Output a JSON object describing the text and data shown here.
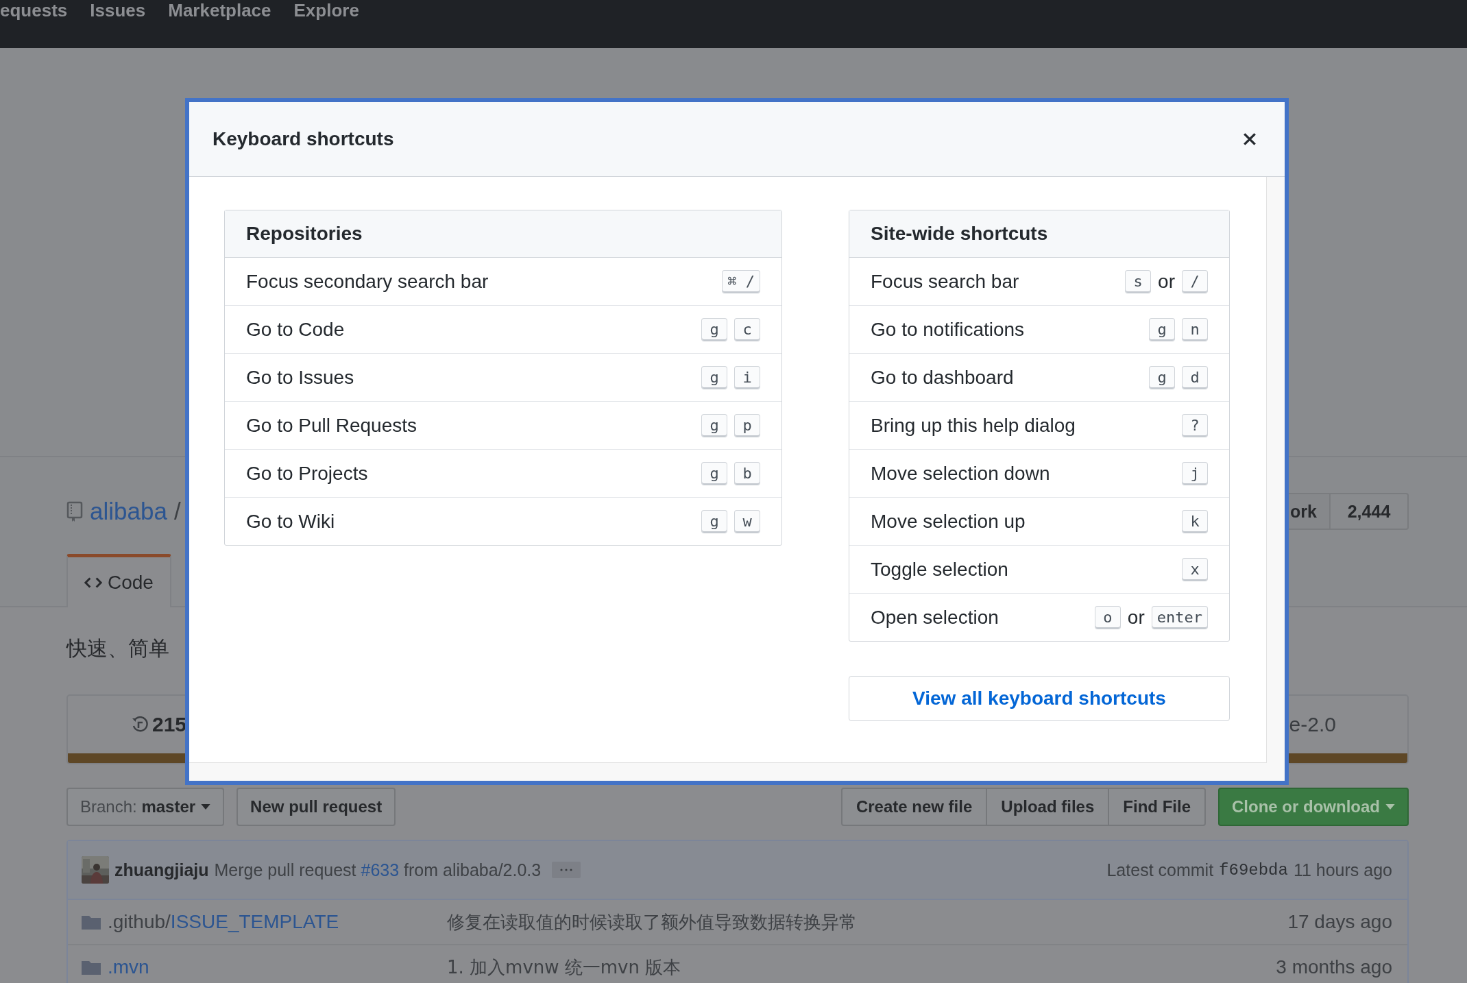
{
  "top_nav": [
    "equests",
    "Issues",
    "Marketplace",
    "Explore"
  ],
  "repo": {
    "owner": "alibaba",
    "separator": "/",
    "fork_label": "ork",
    "fork_count": "2,444"
  },
  "tabs": [
    {
      "label": "Code",
      "selected": true
    }
  ],
  "description": "快速、简单",
  "stats": {
    "commits": "215",
    "license": "e-2.0"
  },
  "branch": {
    "label": "Branch:",
    "value": "master"
  },
  "new_pull_request": "New pull request",
  "file_actions": [
    "Create new file",
    "Upload files",
    "Find File"
  ],
  "clone_button": "Clone or download",
  "commit": {
    "author": "zhuangjiaju",
    "message_before": "Merge pull request",
    "pr": "#633",
    "message_after": "from alibaba/2.0.3",
    "latest_label": "Latest commit",
    "sha": "f69ebda",
    "time": "11 hours ago"
  },
  "files": [
    {
      "path": ".github/",
      "name": "ISSUE_TEMPLATE",
      "message": "修复在读取值的时候读取了额外值导致数据转换异常",
      "age": "17 days ago"
    },
    {
      "name": ".mvn",
      "message": "1. 加入mvnw 统一mvn 版本",
      "age": "3 months ago"
    }
  ],
  "dialog": {
    "title": "Keyboard shortcuts",
    "sections": [
      {
        "title": "Repositories",
        "shortcuts": [
          {
            "label": "Focus secondary search bar",
            "keys": [
              {
                "kind": "key",
                "text": "⌘ /"
              }
            ]
          },
          {
            "label": "Go to Code",
            "keys": [
              {
                "kind": "key",
                "text": "g"
              },
              {
                "kind": "key",
                "text": "c"
              }
            ]
          },
          {
            "label": "Go to Issues",
            "keys": [
              {
                "kind": "key",
                "text": "g"
              },
              {
                "kind": "key",
                "text": "i"
              }
            ]
          },
          {
            "label": "Go to Pull Requests",
            "keys": [
              {
                "kind": "key",
                "text": "g"
              },
              {
                "kind": "key",
                "text": "p"
              }
            ]
          },
          {
            "label": "Go to Projects",
            "keys": [
              {
                "kind": "key",
                "text": "g"
              },
              {
                "kind": "key",
                "text": "b"
              }
            ]
          },
          {
            "label": "Go to Wiki",
            "keys": [
              {
                "kind": "key",
                "text": "g"
              },
              {
                "kind": "key",
                "text": "w"
              }
            ]
          }
        ]
      },
      {
        "title": "Site-wide shortcuts",
        "shortcuts": [
          {
            "label": "Focus search bar",
            "keys": [
              {
                "kind": "key",
                "text": "s"
              },
              {
                "kind": "word",
                "text": "or"
              },
              {
                "kind": "key",
                "text": "/"
              }
            ]
          },
          {
            "label": "Go to notifications",
            "keys": [
              {
                "kind": "key",
                "text": "g"
              },
              {
                "kind": "key",
                "text": "n"
              }
            ]
          },
          {
            "label": "Go to dashboard",
            "keys": [
              {
                "kind": "key",
                "text": "g"
              },
              {
                "kind": "key",
                "text": "d"
              }
            ]
          },
          {
            "label": "Bring up this help dialog",
            "keys": [
              {
                "kind": "key",
                "text": "?"
              }
            ]
          },
          {
            "label": "Move selection down",
            "keys": [
              {
                "kind": "key",
                "text": "j"
              }
            ]
          },
          {
            "label": "Move selection up",
            "keys": [
              {
                "kind": "key",
                "text": "k"
              }
            ]
          },
          {
            "label": "Toggle selection",
            "keys": [
              {
                "kind": "key",
                "text": "x"
              }
            ]
          },
          {
            "label": "Open selection",
            "keys": [
              {
                "kind": "key",
                "text": "o"
              },
              {
                "kind": "word",
                "text": "or"
              },
              {
                "kind": "key",
                "text": "enter"
              }
            ]
          }
        ]
      }
    ],
    "footer_link": "View all keyboard shortcuts"
  }
}
